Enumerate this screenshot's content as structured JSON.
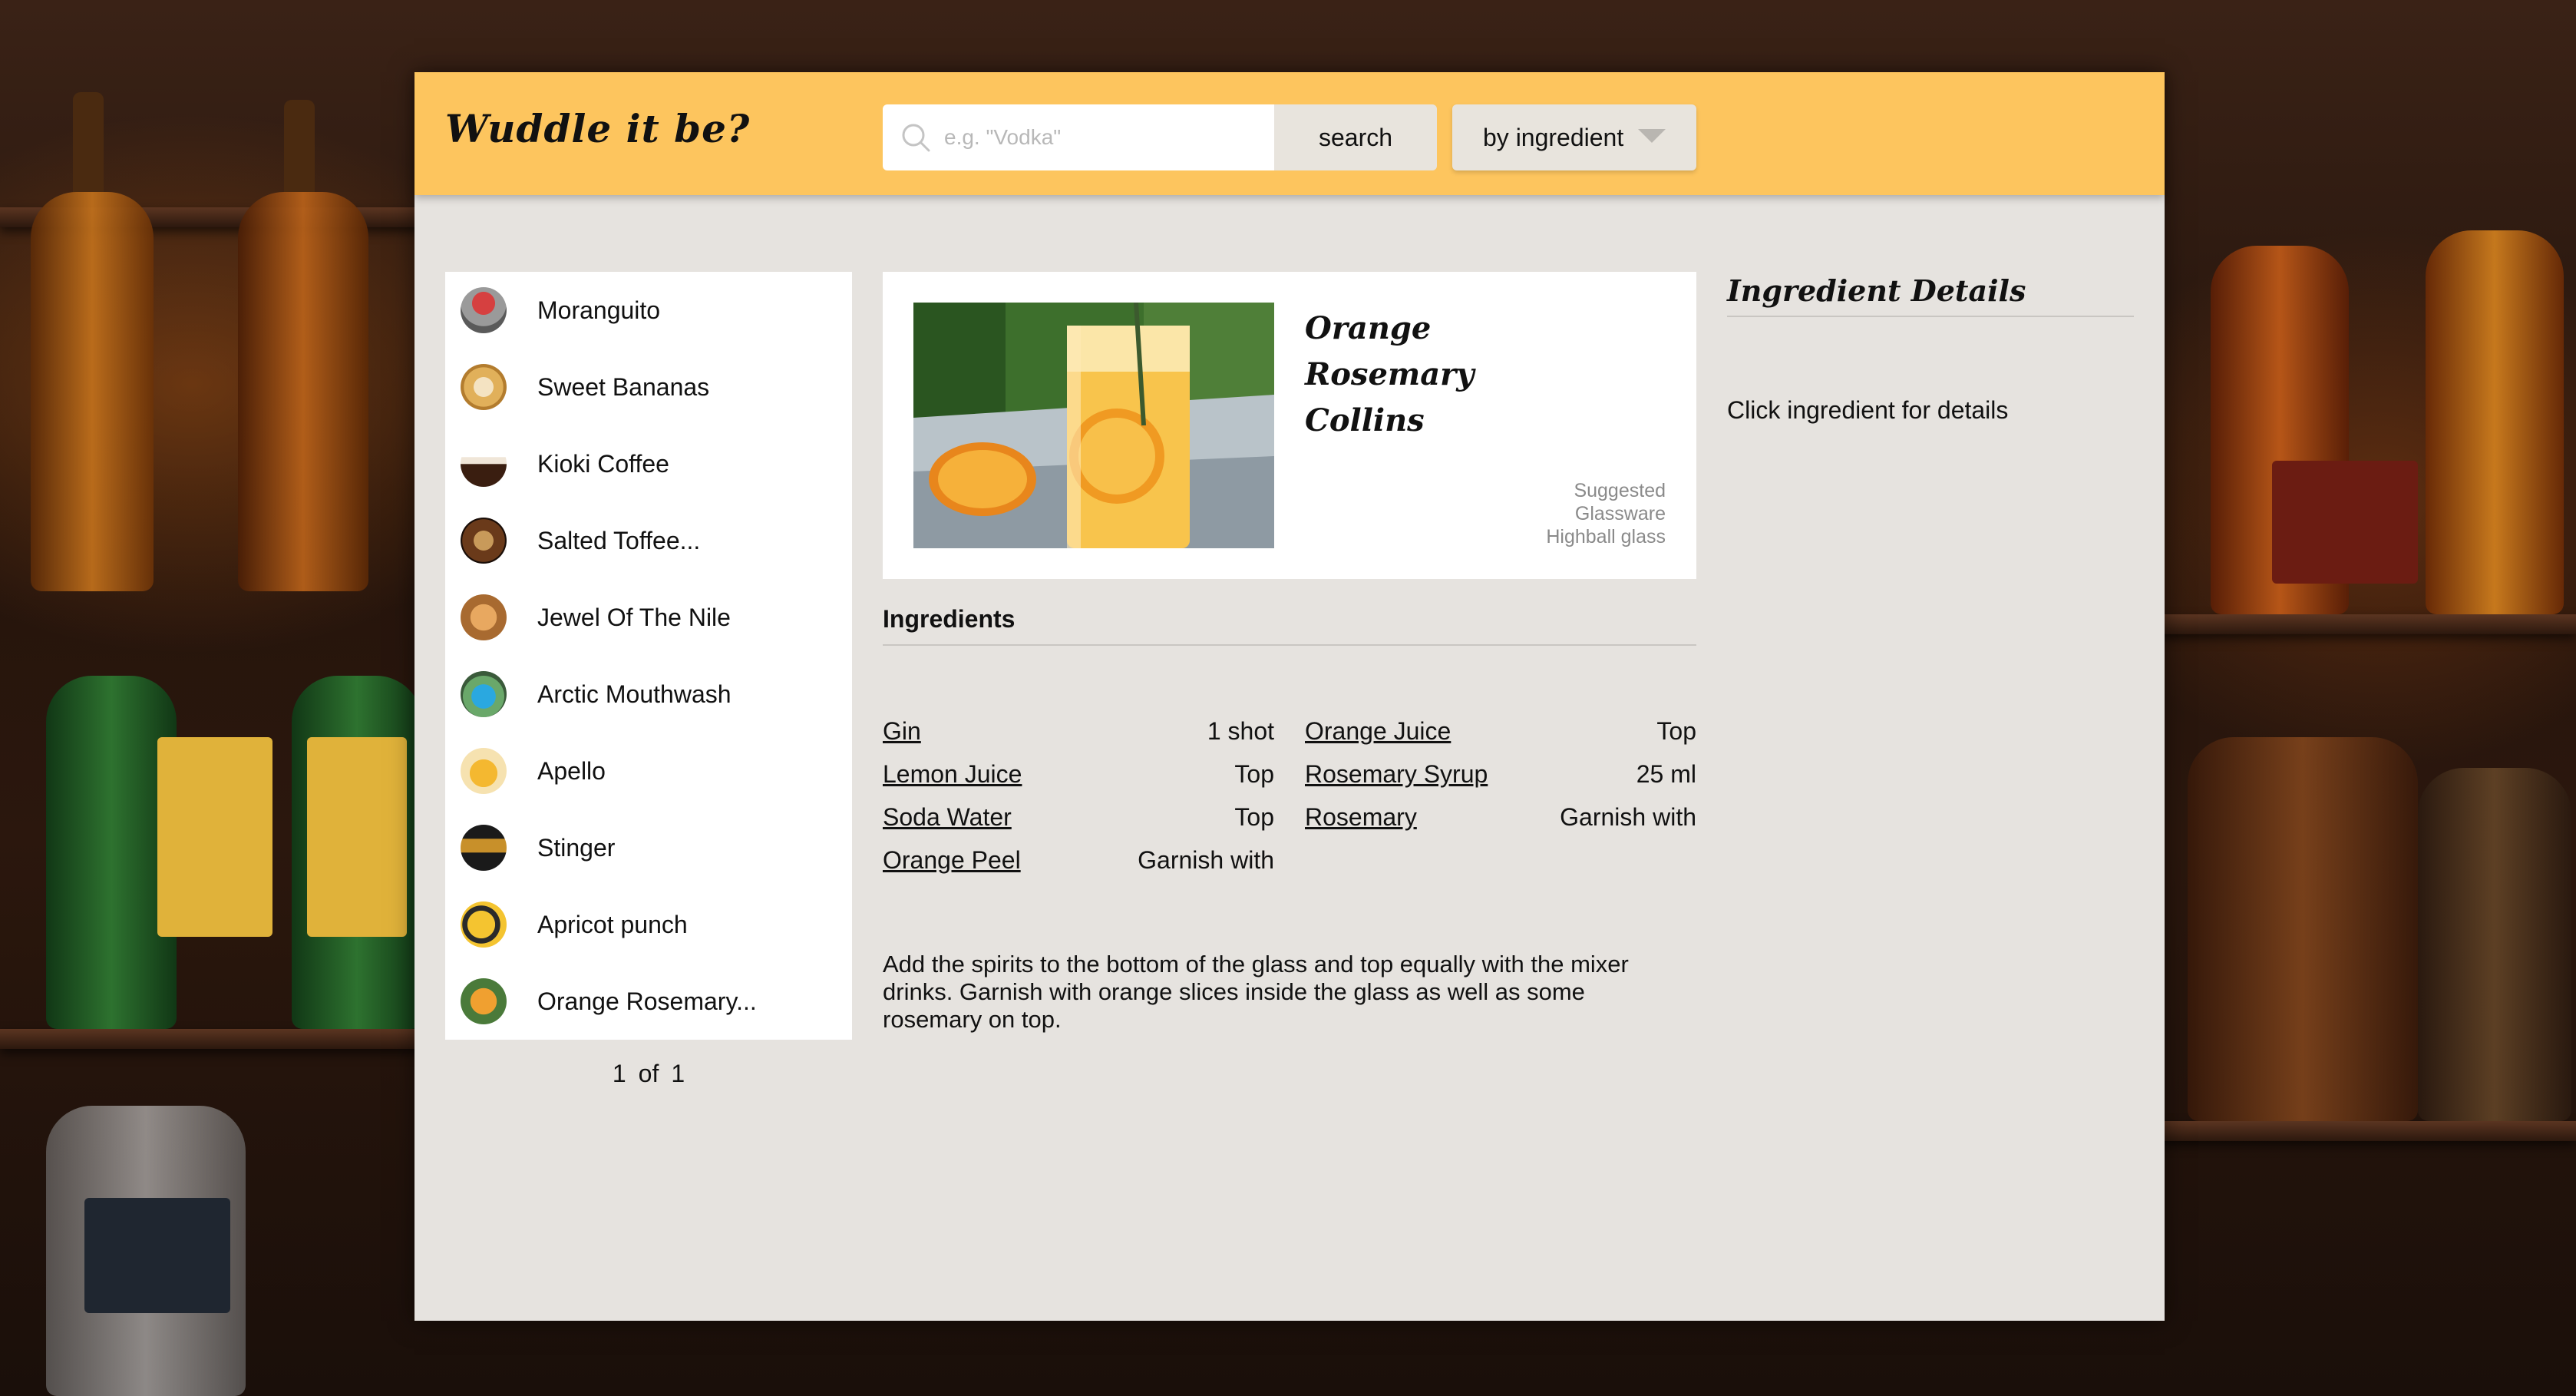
{
  "header": {
    "logo": "Wuddle it be?",
    "search": {
      "placeholder": "e.g. \"Vodka\"",
      "value": "",
      "button_label": "search",
      "icon": "search-icon"
    },
    "mode_select": {
      "selected": "by ingredient",
      "icon": "caret-down-icon"
    }
  },
  "drinks": [
    {
      "name": "Moranguito"
    },
    {
      "name": "Sweet Bananas"
    },
    {
      "name": "Kioki Coffee"
    },
    {
      "name": "Salted Toffee..."
    },
    {
      "name": "Jewel Of The Nile"
    },
    {
      "name": "Arctic Mouthwash"
    },
    {
      "name": "Apello"
    },
    {
      "name": "Stinger"
    },
    {
      "name": "Apricot punch"
    },
    {
      "name": "Orange Rosemary..."
    }
  ],
  "pagination": {
    "current": "1",
    "separator": "of",
    "total": "1"
  },
  "detail": {
    "title": "Orange Rosemary Collins",
    "glassware_label_1": "Suggested",
    "glassware_label_2": "Glassware",
    "glassware": "Highball glass",
    "ingredients_heading": "Ingredients",
    "ingredients": [
      {
        "name": "Gin",
        "amount": "1 shot"
      },
      {
        "name": "Orange Juice",
        "amount": "Top"
      },
      {
        "name": "Lemon Juice",
        "amount": "Top"
      },
      {
        "name": "Rosemary Syrup",
        "amount": "25 ml"
      },
      {
        "name": "Soda Water",
        "amount": "Top"
      },
      {
        "name": "Rosemary",
        "amount": "Garnish with"
      },
      {
        "name": "Orange Peel",
        "amount": "Garnish with"
      }
    ],
    "instructions": "Add the spirits to the bottom of the glass and top equally with the mixer drinks. Garnish with orange slices inside the glass as well as some rosemary on top."
  },
  "ingredient_details": {
    "title": "Ingredient Details",
    "placeholder": "Click ingredient for details"
  },
  "colors": {
    "header": "#fdc55e",
    "panel": "#e6e3df",
    "card": "#ffffff",
    "button": "#e8e4dd"
  }
}
